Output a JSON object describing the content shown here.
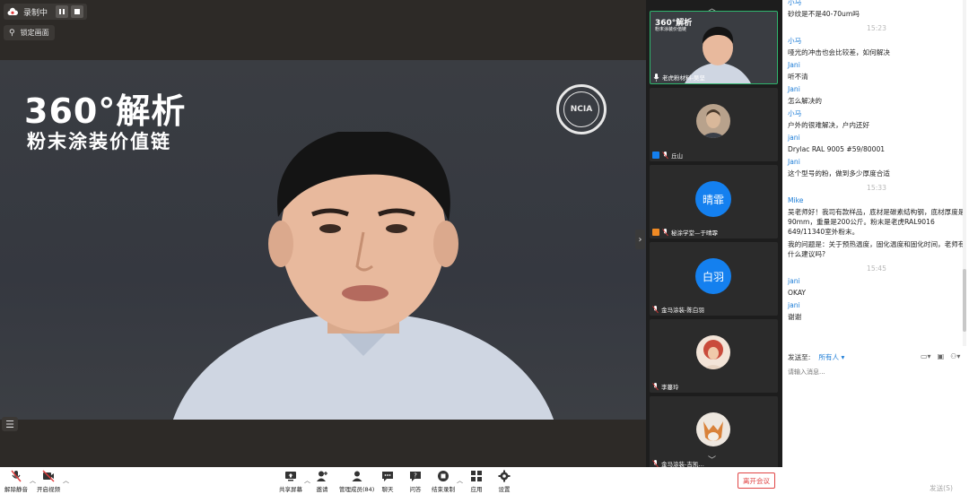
{
  "recording": {
    "label": "录制中"
  },
  "pin": {
    "label": "锁定画面"
  },
  "slide": {
    "title": "360°解析",
    "subtitle": "粉末涂装价值链",
    "logo_text": "NCIA"
  },
  "thumbnails": [
    {
      "name": "老虎粉材料-吴坚",
      "type": "video",
      "title": "360°解析",
      "subtitle": "粉末涂装价值链"
    },
    {
      "name": "丘山",
      "type": "photo"
    },
    {
      "name": "秘涂学堂—于晴霏",
      "type": "initials",
      "initials": "晴霏"
    },
    {
      "name": "金马涂装-陈白羽",
      "type": "initials",
      "initials": "白羽"
    },
    {
      "name": "李蔓玲",
      "type": "photo"
    },
    {
      "name": "金马涂装-吉凯…",
      "type": "photo"
    }
  ],
  "chat": {
    "messages": [
      {
        "name": "小马",
        "text": "砂纹是不是40-70um吗"
      },
      {
        "time": "15:23"
      },
      {
        "name": "小马",
        "text": "哑光的冲击也会比较差，如何解决"
      },
      {
        "name": "Jani",
        "text": "听不清"
      },
      {
        "name": "Jani",
        "text": "怎么解决的"
      },
      {
        "name": "小马",
        "text": "户外的很难解决，户内还好"
      },
      {
        "name": "jani",
        "text": "Drylac RAL 9005 #59/80001"
      },
      {
        "name": "Jani",
        "text": "这个型号的粉，做到多少厚度合适"
      },
      {
        "time": "15:33"
      },
      {
        "name": "Mike",
        "text": "吴老师好！我司有款样品，底材是碳素结构钢，底材厚度是90mm，重量是200公斤。粉末是老虎RAL9016 649/11340室外粉末。"
      },
      {
        "name": "",
        "text": "我的问题是：关于预热温度，固化温度和固化时间，老师有什么建议吗?"
      },
      {
        "time": "15:45"
      },
      {
        "name": "jani",
        "text": "OKAY"
      },
      {
        "name": "jani",
        "text": "谢谢"
      }
    ],
    "send_to_label": "发送至:",
    "send_to_value": "所有人",
    "input_placeholder": "请输入消息...",
    "send_label": "发送(S)"
  },
  "toolbar": {
    "unmute": "解除静音",
    "start_video": "开启视频",
    "share": "共享屏幕",
    "invite": "邀请",
    "members": "管理成员(84)",
    "chat": "聊天",
    "qa": "问答",
    "end_record": "结束录制",
    "apps": "应用",
    "settings": "设置",
    "leave": "离开会议"
  }
}
